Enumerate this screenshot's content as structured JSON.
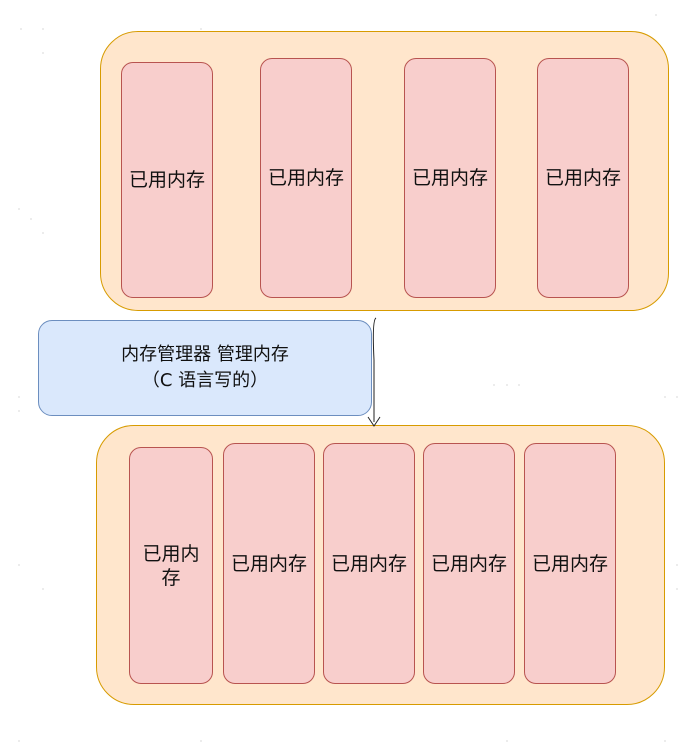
{
  "diagram": {
    "top_group": {
      "blocks": [
        "已用内存",
        "已用内存",
        "已用内存",
        "已用内存"
      ]
    },
    "manager": {
      "line1": "内存管理器 管理内存",
      "line2": "（C 语言写的）"
    },
    "bottom_group": {
      "blocks": [
        "已用内存",
        "已用内存",
        "已用内存",
        "已用内存",
        "已用内存"
      ]
    }
  },
  "colors": {
    "container_fill": "#ffe6cc",
    "container_stroke": "#d79b00",
    "block_fill": "#f8cecc",
    "block_stroke": "#b85450",
    "manager_fill": "#dae8fc",
    "manager_stroke": "#6c8ebf"
  }
}
